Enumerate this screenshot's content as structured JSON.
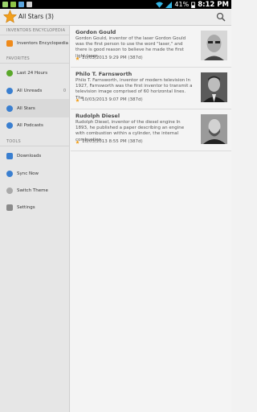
{
  "status_bar": {
    "battery": "41%",
    "time": "8:12 PM"
  },
  "action_bar": {
    "title": "All Stars (3)"
  },
  "sidebar": {
    "sections": [
      {
        "header": "INVENTORS ENCYCLOPEDIA",
        "items": [
          {
            "label": "Inventors Encyclopedia",
            "icon": "rss-icon"
          }
        ]
      },
      {
        "header": "FAVORITES",
        "items": [
          {
            "label": "Last 24 Hours",
            "icon": "clock-icon"
          },
          {
            "label": "All Unreads",
            "icon": "unread-icon",
            "badge": "0"
          },
          {
            "label": "All Stars",
            "icon": "star-circle-icon"
          },
          {
            "label": "All Podcasts",
            "icon": "podcast-icon"
          }
        ]
      },
      {
        "header": "TOOLS",
        "items": [
          {
            "label": "Downloads",
            "icon": "download-icon"
          },
          {
            "label": "Sync Now",
            "icon": "sync-icon"
          },
          {
            "label": "Switch Theme",
            "icon": "theme-icon"
          },
          {
            "label": "Settings",
            "icon": "settings-icon"
          }
        ]
      }
    ]
  },
  "articles": [
    {
      "title": "Gordon Gould",
      "body": "Gordon Gould, inventor of the laser Gordon Gould was the first person to use the word \"laser,\" and there is good reason to believe he made the first light laser.",
      "meta": "10/03/2013 9:29 PM (387d)"
    },
    {
      "title": "Philo T. Farnsworth",
      "body": "Philo T. Farnsworth, inventor of modern television In 1927, Farnsworth was the first inventor to transmit a television image comprised of 60 horizontal lines. The",
      "meta": "10/03/2013 9:07 PM (387d)"
    },
    {
      "title": "Rudolph Diesel",
      "body": "Rudolph Diesel, inventor of the diesel engine In 1893, he published a paper describing an engine with combustion within a cylinder, the internal combustion",
      "meta": "10/03/2013 8:55 PM (387d)"
    }
  ],
  "colors": {
    "accent_star": "#f2a01e",
    "feed_orange": "#ef8a1a",
    "green": "#5aa82a",
    "blue": "#3a7fd0"
  }
}
